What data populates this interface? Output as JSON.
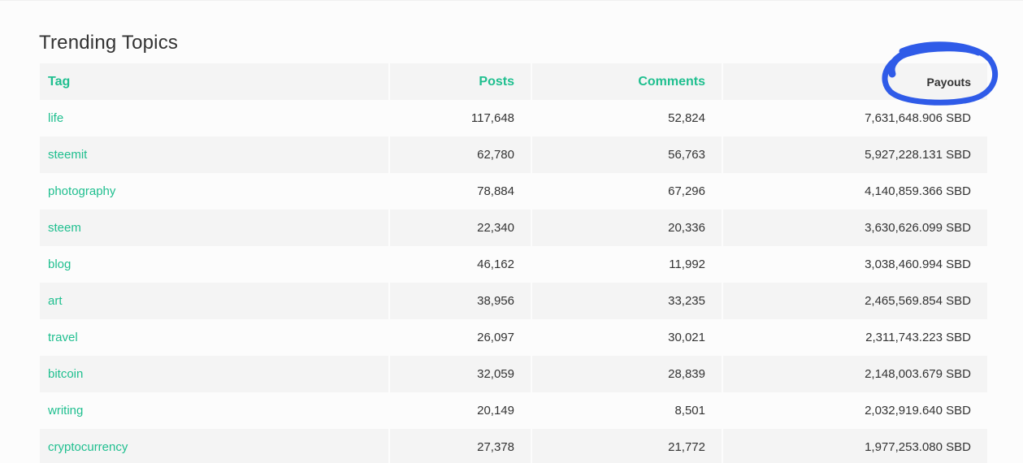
{
  "page": {
    "title": "Trending Topics"
  },
  "table": {
    "headers": {
      "tag": "Tag",
      "posts": "Posts",
      "comments": "Comments",
      "payouts": "Payouts"
    },
    "rows": [
      {
        "tag": "life",
        "posts": "117,648",
        "comments": "52,824",
        "payouts": "7,631,648.906 SBD"
      },
      {
        "tag": "steemit",
        "posts": "62,780",
        "comments": "56,763",
        "payouts": "5,927,228.131 SBD"
      },
      {
        "tag": "photography",
        "posts": "78,884",
        "comments": "67,296",
        "payouts": "4,140,859.366 SBD"
      },
      {
        "tag": "steem",
        "posts": "22,340",
        "comments": "20,336",
        "payouts": "3,630,626.099 SBD"
      },
      {
        "tag": "blog",
        "posts": "46,162",
        "comments": "11,992",
        "payouts": "3,038,460.994 SBD"
      },
      {
        "tag": "art",
        "posts": "38,956",
        "comments": "33,235",
        "payouts": "2,465,569.854 SBD"
      },
      {
        "tag": "travel",
        "posts": "26,097",
        "comments": "30,021",
        "payouts": "2,311,743.223 SBD"
      },
      {
        "tag": "bitcoin",
        "posts": "32,059",
        "comments": "28,839",
        "payouts": "2,148,003.679 SBD"
      },
      {
        "tag": "writing",
        "posts": "20,149",
        "comments": "8,501",
        "payouts": "2,032,919.640 SBD"
      },
      {
        "tag": "cryptocurrency",
        "posts": "27,378",
        "comments": "21,772",
        "payouts": "1,977,253.080 SBD"
      }
    ]
  },
  "colors": {
    "accent": "#1fbf8f",
    "text": "#333333",
    "row_shade": "#f4f4f4",
    "annotation": "#2f5be8"
  }
}
